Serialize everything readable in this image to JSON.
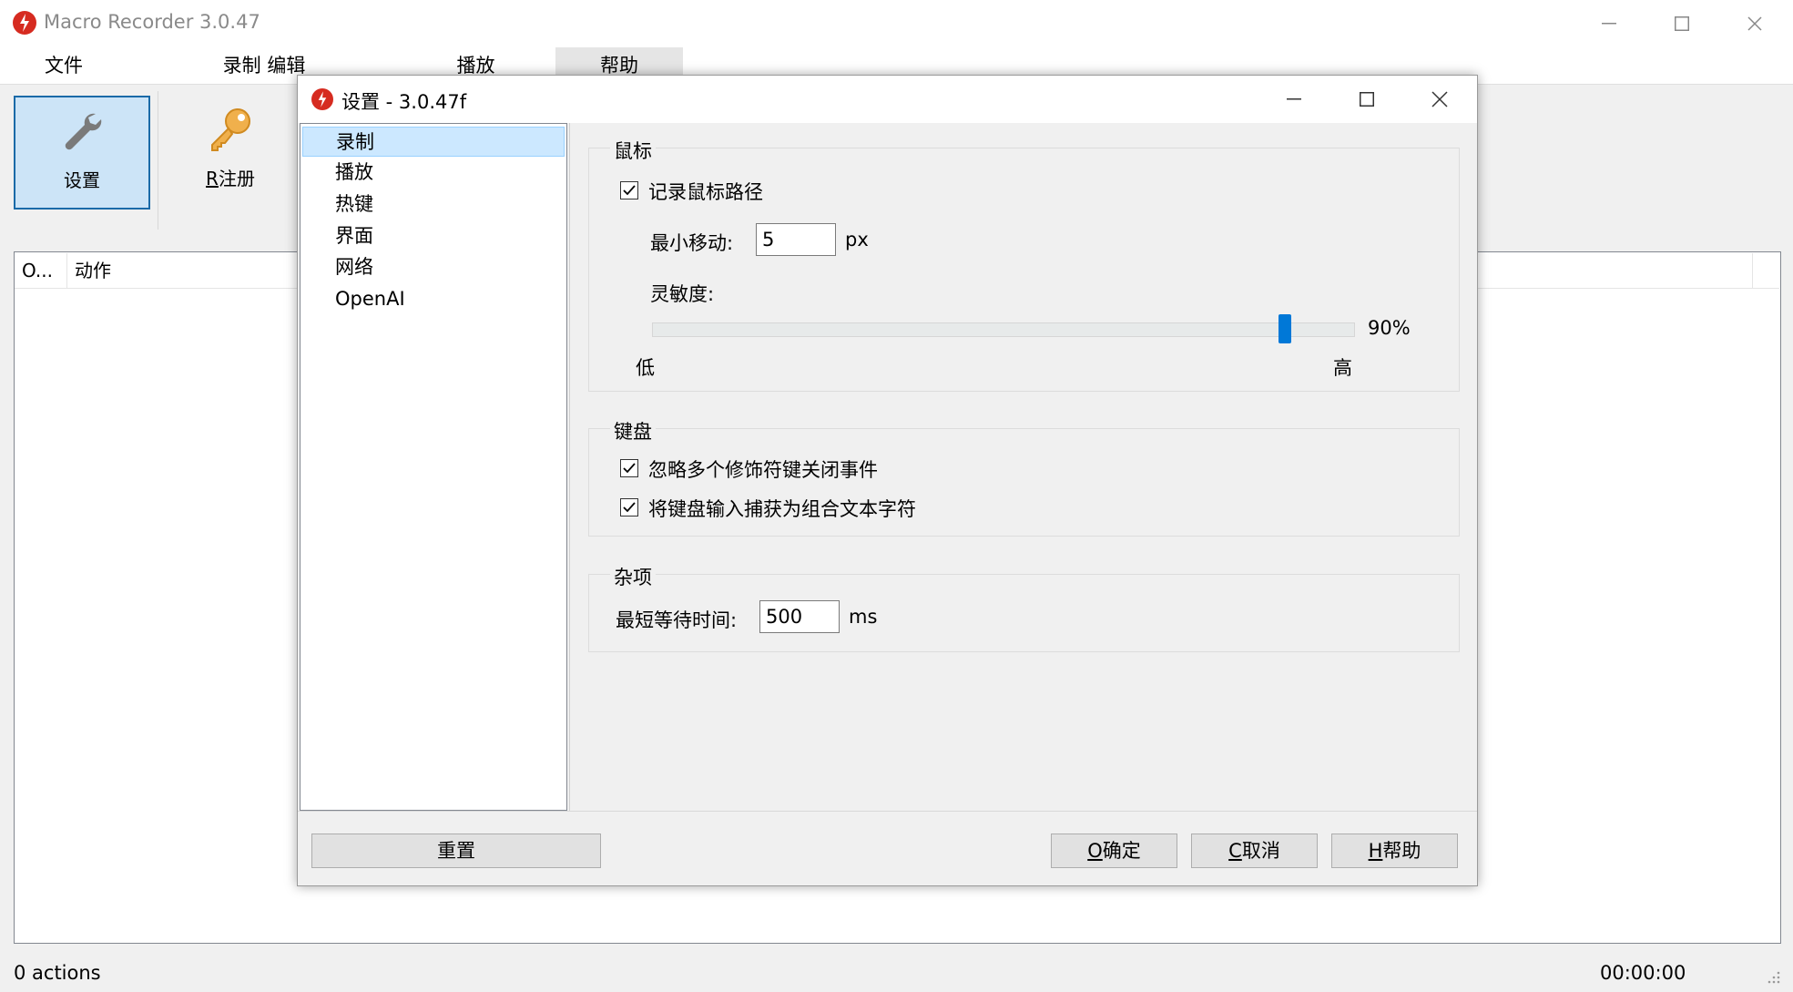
{
  "app": {
    "title": "Macro Recorder 3.0.47",
    "window_controls": [
      "minimize",
      "maximize",
      "close"
    ]
  },
  "menu": {
    "items": [
      "文件",
      "录制 编辑",
      "播放",
      "帮助"
    ]
  },
  "toolbar": {
    "settings_label": "设置",
    "register_label": "注册",
    "register_accel": "R"
  },
  "list": {
    "columns": [
      "O...",
      "动作"
    ]
  },
  "statusbar": {
    "actions": "0 actions",
    "time": "00:00:00"
  },
  "dialog": {
    "title": "设置 - 3.0.47f",
    "nav": [
      "录制",
      "播放",
      "热键",
      "界面",
      "网络",
      "OpenAI"
    ],
    "selected_nav": "录制",
    "mouse": {
      "group_label": "鼠标",
      "record_path_label": "记录鼠标路径",
      "record_path_checked": true,
      "min_move_label": "最小移动:",
      "min_move_value": "5",
      "min_move_unit": "px",
      "sensitivity_label": "灵敏度:",
      "sensitivity_value": 0.9,
      "sensitivity_text": "90%",
      "low_label": "低",
      "high_label": "高"
    },
    "keyboard": {
      "group_label": "键盘",
      "ignore_modifiers_label": "忽略多个修饰符键关闭事件",
      "ignore_modifiers_checked": true,
      "capture_text_label": "将键盘输入捕获为组合文本字符",
      "capture_text_checked": true
    },
    "misc": {
      "group_label": "杂项",
      "min_wait_label": "最短等待时间:",
      "min_wait_value": "500",
      "min_wait_unit": "ms"
    },
    "buttons": {
      "reset": "重置",
      "ok_accel": "O",
      "ok": "确定",
      "cancel_accel": "C",
      "cancel": "取消",
      "help_accel": "H",
      "help": "帮助"
    }
  }
}
